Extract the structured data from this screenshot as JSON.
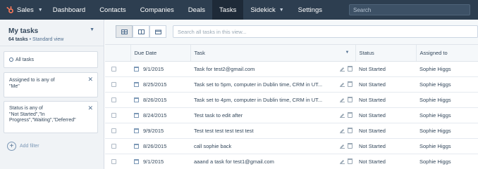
{
  "nav": {
    "brand": "Sales",
    "items": [
      {
        "label": "Dashboard",
        "active": false
      },
      {
        "label": "Contacts",
        "active": false
      },
      {
        "label": "Companies",
        "active": false
      },
      {
        "label": "Deals",
        "active": false
      },
      {
        "label": "Tasks",
        "active": true
      },
      {
        "label": "Sidekick",
        "active": false,
        "dropdown": true
      },
      {
        "label": "Settings",
        "active": false
      }
    ],
    "search_placeholder": "Search"
  },
  "sidebar": {
    "title": "My tasks",
    "count": "64 tasks",
    "view": " • Standard view",
    "all_tasks": "All tasks",
    "filters": [
      {
        "text": "Assigned to is any of\n\"Me\""
      },
      {
        "text": "Status is any of\n\"Not Started\",\"In\nProgress\",\"Waiting\",\"Deferred\""
      }
    ],
    "add_filter": "Add filter"
  },
  "toolbar": {
    "search_placeholder": "Search all tasks in this view..."
  },
  "table": {
    "columns": [
      "",
      "Due Date",
      "Task",
      "Status",
      "Assigned to"
    ],
    "rows": [
      {
        "due": "9/1/2015",
        "task": "Task for test2@gmail.com",
        "status": "Not Started",
        "assigned": "Sophie Higgs"
      },
      {
        "due": "8/25/2015",
        "task": "Task set to 5pm, computer in Dublin time, CRM in UT...",
        "status": "Not Started",
        "assigned": "Sophie Higgs"
      },
      {
        "due": "8/26/2015",
        "task": "Task set to 4pm, computer in Dublin time, CRM in UT...",
        "status": "Not Started",
        "assigned": "Sophie Higgs"
      },
      {
        "due": "8/24/2015",
        "task": "Test task to edit after",
        "status": "Not Started",
        "assigned": "Sophie Higgs"
      },
      {
        "due": "9/9/2015",
        "task": "Test test test test test test",
        "status": "Not Started",
        "assigned": "Sophie Higgs"
      },
      {
        "due": "8/26/2015",
        "task": "call sophie back",
        "status": "Not Started",
        "assigned": "Sophie Higgs"
      },
      {
        "due": "9/1/2015",
        "task": "aaand a task for test1@gmail.com",
        "status": "Not Started",
        "assigned": "Sophie Higgs"
      }
    ]
  }
}
